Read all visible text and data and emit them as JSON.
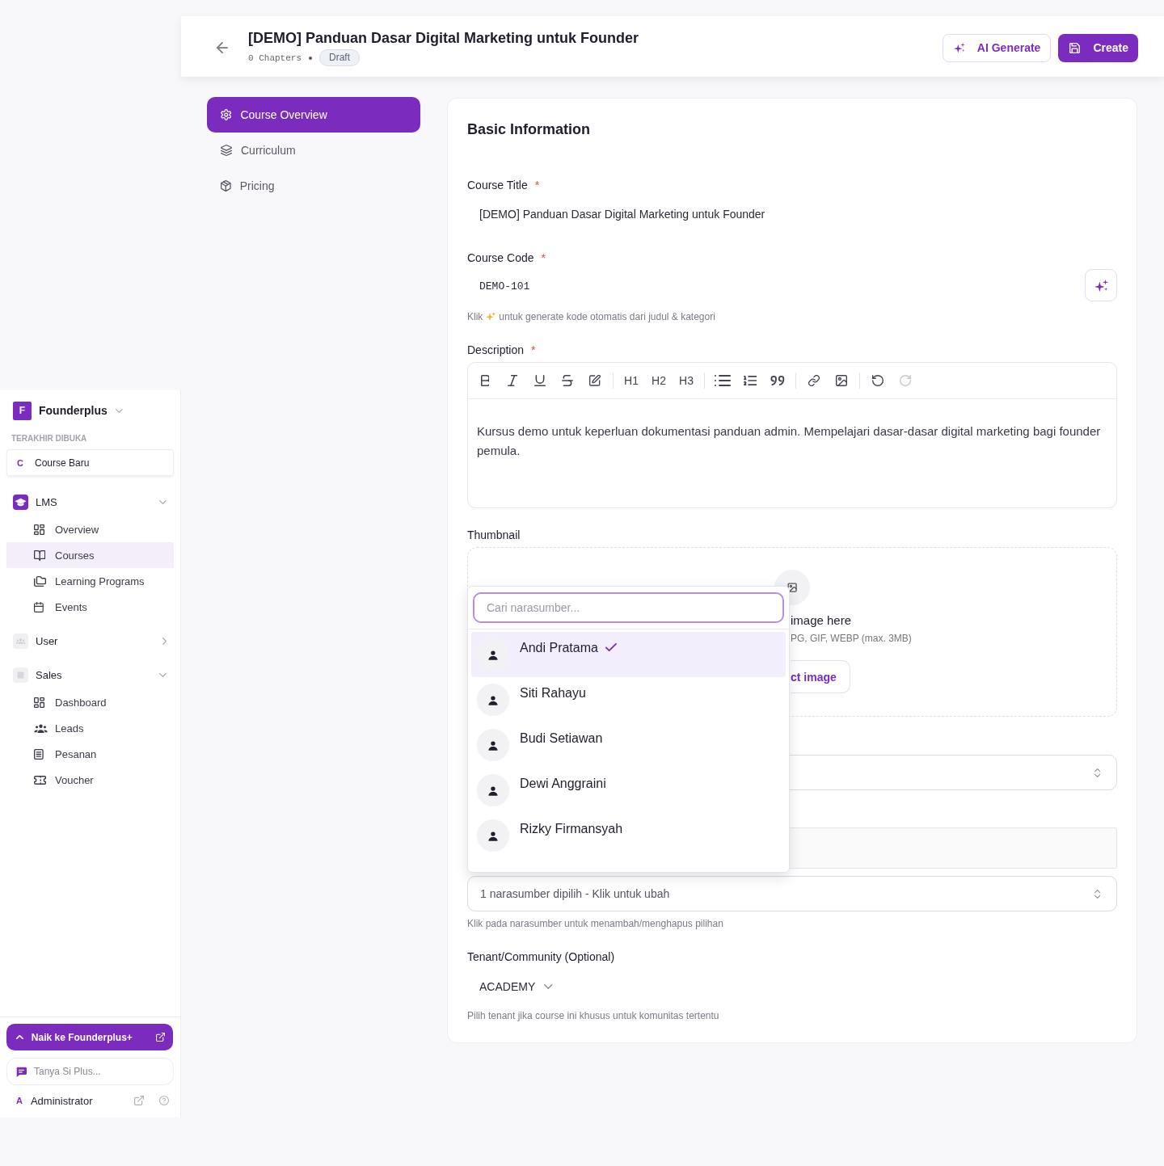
{
  "sidebar": {
    "brand": {
      "initial": "F",
      "name": "Founderplus"
    },
    "recent_heading": "TERAKHIR DIBUKA",
    "recent": [
      {
        "initial": "C",
        "label": "Course Baru"
      }
    ],
    "groups": [
      {
        "kind": "lms",
        "label": "LMS",
        "expanded": true,
        "items": [
          {
            "kind": "grid",
            "label": "Overview",
            "selected": false
          },
          {
            "kind": "book",
            "label": "Courses",
            "selected": true
          },
          {
            "kind": "folders",
            "label": "Learning Programs",
            "selected": false
          },
          {
            "kind": "calendar",
            "label": "Events",
            "selected": false
          }
        ]
      },
      {
        "kind": "user",
        "label": "User",
        "expanded": false
      },
      {
        "kind": "sales",
        "label": "Sales",
        "expanded": true,
        "items": [
          {
            "kind": "grid",
            "label": "Dashboard",
            "selected": false
          },
          {
            "kind": "people",
            "label": "Leads",
            "selected": false
          },
          {
            "kind": "list",
            "label": "Pesanan",
            "selected": false
          },
          {
            "kind": "ticket",
            "label": "Voucher",
            "selected": false
          }
        ]
      }
    ],
    "upgrade_button": "Naik ke Founderplus+",
    "assistant_field": {
      "placeholder": "Tanya Si Plus..."
    },
    "user": {
      "initial": "A",
      "name": "Administrator"
    }
  },
  "header": {
    "title": "[DEMO] Panduan Dasar Digital Marketing untuk Founder",
    "chapters": "0 Chapters",
    "status": "Draft",
    "actions": [
      {
        "kind": "outline",
        "label": "AI Generate"
      },
      {
        "kind": "primary",
        "label": "Create"
      }
    ]
  },
  "course_nav": [
    {
      "kind": "gear",
      "label": "Course Overview",
      "selected": true
    },
    {
      "kind": "layers",
      "label": "Curriculum",
      "selected": false
    },
    {
      "kind": "package",
      "label": "Pricing",
      "selected": false
    }
  ],
  "basic_information": {
    "title": "Basic Information",
    "fields": [
      {
        "kind": "text",
        "label": "Course Title",
        "required_mark": "*",
        "value": "[DEMO] Panduan Dasar Digital Marketing untuk Founder"
      },
      {
        "kind": "code",
        "label": "Course Code",
        "required_mark": "*",
        "value": "DEMO-101",
        "hint_start": "Klik",
        "hint_end": "untuk generate kode otomatis dari judul & kategori"
      },
      {
        "kind": "editor",
        "label": "Description",
        "required_mark": "*",
        "toolbar": [
          [
            {
              "kind": "bold",
              "disabled": false
            },
            {
              "kind": "italic",
              "disabled": false
            },
            {
              "kind": "underline",
              "disabled": false
            },
            {
              "kind": "strike",
              "disabled": false
            },
            {
              "kind": "edit",
              "disabled": false
            }
          ],
          [
            {
              "kind": "heading",
              "label": "H1",
              "disabled": false
            },
            {
              "kind": "heading",
              "label": "H2",
              "disabled": false
            },
            {
              "kind": "heading",
              "label": "H3",
              "disabled": false
            }
          ],
          [
            {
              "kind": "bullets",
              "disabled": false
            },
            {
              "kind": "numbers",
              "disabled": false
            },
            {
              "kind": "quote",
              "disabled": false
            }
          ],
          [
            {
              "kind": "link",
              "disabled": false
            },
            {
              "kind": "image",
              "disabled": false
            }
          ],
          [
            {
              "kind": "undo",
              "disabled": false
            },
            {
              "kind": "redo",
              "disabled": true
            }
          ]
        ],
        "value": "Kursus demo untuk keperluan dokumentasi panduan admin. Mempelajari dasar-dasar digital marketing bagi founder pemula."
      },
      {
        "kind": "upload",
        "label": "Thumbnail",
        "prompt": "image here",
        "formats": "PG, GIF, WEBP (max. 3MB)",
        "button": "ct image"
      },
      {
        "kind": "select"
      },
      {
        "kind": "input"
      },
      {
        "kind": "multi_select",
        "value": "1 narasumber dipilih - Klik untuk ubah",
        "hint": "Klik pada narasumber untuk menambah/menghapus pilihan",
        "popup": {
          "search": {
            "placeholder": "Cari narasumber..."
          },
          "options": [
            {
              "name": "Andi Pratama",
              "selected": true
            },
            {
              "name": "Siti Rahayu",
              "selected": false
            },
            {
              "name": "Budi Setiawan",
              "selected": false
            },
            {
              "name": "Dewi Anggraini",
              "selected": false
            },
            {
              "name": "Rizky Firmansyah",
              "selected": false
            }
          ]
        }
      },
      {
        "kind": "tenant",
        "label": "Tenant/Community (Optional)",
        "value": "ACADEMY",
        "hint": "Pilih tenant jika course ini khusus untuk komunitas tertentu"
      }
    ]
  }
}
